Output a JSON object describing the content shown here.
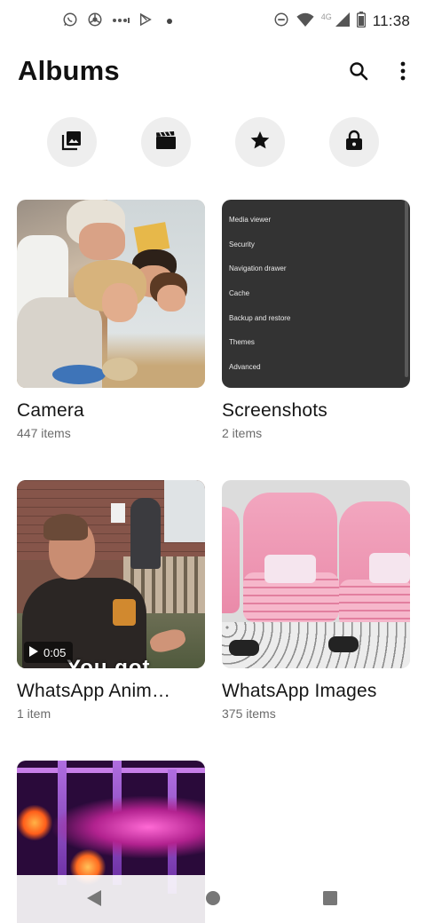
{
  "status_bar": {
    "time": "11:38",
    "network": "4G",
    "left_icons": [
      "whatsapp-icon",
      "chrome-icon",
      "more-dots-icon",
      "play-store-icon",
      "dot-icon"
    ],
    "right_icons": [
      "do-not-disturb-icon",
      "wifi-icon",
      "signal-icon",
      "battery-icon"
    ]
  },
  "app_bar": {
    "title": "Albums",
    "actions": [
      "search-icon",
      "more-vert-icon"
    ]
  },
  "quick_filters": [
    "photos-icon",
    "videos-icon",
    "favorites-icon",
    "vault-icon"
  ],
  "albums": [
    {
      "name": "Camera",
      "count": "447 items"
    },
    {
      "name": "Screenshots",
      "count": "2 items"
    },
    {
      "name": "WhatsApp Anim…",
      "count": "1 item",
      "video_duration": "0:05",
      "thumb_caption": "You got"
    },
    {
      "name": "WhatsApp Images",
      "count": "375 items"
    },
    {
      "name": "",
      "count": ""
    }
  ],
  "screenshot_menu": [
    "Media viewer",
    "Security",
    "Navigation drawer",
    "Cache",
    "Backup and restore",
    "Themes",
    "Advanced"
  ],
  "colors": {
    "background": "#ffffff",
    "quick_button_bg": "#eeeeee",
    "title_text": "#111111",
    "count_text": "#6b6b6b"
  }
}
